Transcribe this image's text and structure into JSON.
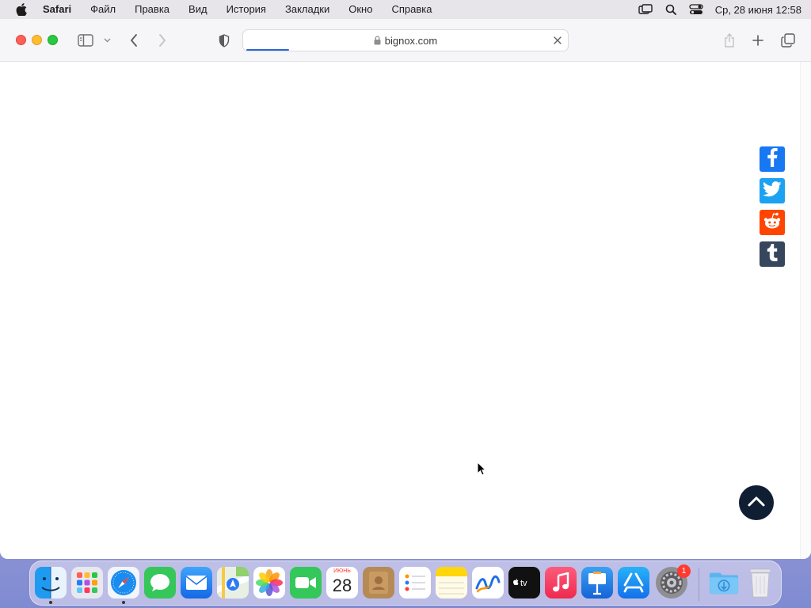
{
  "menubar": {
    "app_name": "Safari",
    "items": [
      "Файл",
      "Правка",
      "Вид",
      "История",
      "Закладки",
      "Окно",
      "Справка"
    ],
    "clock": "Ср, 28 июня  12:58"
  },
  "browser": {
    "address": "bignox.com",
    "loading": true
  },
  "page": {
    "share_buttons": [
      "facebook-icon",
      "twitter-icon",
      "reddit-icon",
      "tumblr-icon"
    ],
    "back_to_top": "chevron-up-icon"
  },
  "dock": {
    "apps": [
      "Finder",
      "Launchpad",
      "Safari",
      "Messages",
      "Mail",
      "Maps",
      "Photos",
      "FaceTime",
      "Calendar",
      "Contacts",
      "Reminders",
      "Notes",
      "Freeform",
      "TV",
      "Music",
      "Keynote",
      "App Store",
      "System Settings"
    ],
    "running": [
      "Finder",
      "Safari"
    ],
    "calendar_month": "ИЮНЬ",
    "calendar_day": "28",
    "settings_badge": "1",
    "extras": [
      "Downloads",
      "Trash"
    ]
  },
  "colors": {
    "facebook": "#1877f2",
    "twitter": "#1da1f2",
    "reddit": "#ff4500",
    "tumblr": "#36465d",
    "back_to_top": "#0f1e33",
    "progress": "#2a67d3"
  }
}
